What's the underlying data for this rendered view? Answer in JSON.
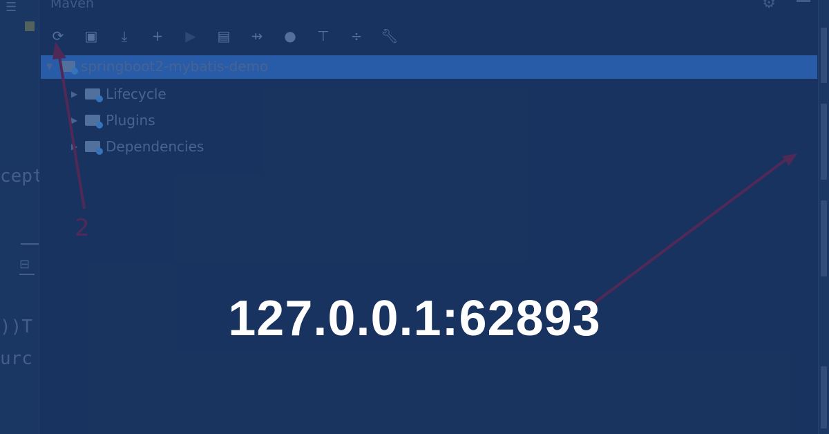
{
  "background_ide": {
    "panel_title": "Maven",
    "project_label": "springboot2-mybatis-demo",
    "tree_items": [
      {
        "label": "Lifecycle",
        "icon": "lifecycle-folder-icon"
      },
      {
        "label": "Plugins",
        "icon": "plugins-folder-icon"
      },
      {
        "label": "Dependencies",
        "icon": "dependencies-folder-icon"
      }
    ],
    "code_fragments": [
      "cept",
      "))T",
      "urc"
    ],
    "annotation_number": "2",
    "toolbar_icons": [
      "reload-icon",
      "folder-sync-icon",
      "download-icon",
      "plus-icon",
      "run-icon",
      "execute-goal-icon",
      "toggle-offline-icon",
      "skip-tests-icon",
      "show-dependencies-icon",
      "collapse-icon",
      "wrench-icon"
    ],
    "colors": {
      "selection": "#2c64b3",
      "background": "#1b3560",
      "annotation_arrow": "#5a2a55"
    }
  },
  "overlay": {
    "headline": "127.0.0.1:62893",
    "text_color": "#ffffff"
  }
}
